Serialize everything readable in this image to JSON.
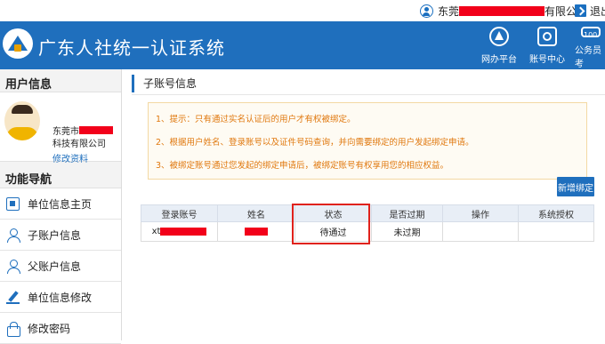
{
  "topbar": {
    "company_prefix": "东莞",
    "company_suffix": "有限公司",
    "logout_label": "退出"
  },
  "header": {
    "title": "广东人社统一认证系统",
    "nav": [
      {
        "label": "网办平台",
        "icon": "service-hall-icon"
      },
      {
        "label": "账号中心",
        "icon": "account-center-icon"
      },
      {
        "label": "公务员考",
        "icon": "civil-exam-icon"
      }
    ]
  },
  "sidebar": {
    "user_info_heading": "用户信息",
    "company_line1_prefix": "东莞市",
    "company_line2": "科技有限公司",
    "edit_profile": "修改资料",
    "nav_heading": "功能导航",
    "items": [
      {
        "label": "单位信息主页",
        "icon": "home-icon"
      },
      {
        "label": "子账户信息",
        "icon": "sub-account-icon"
      },
      {
        "label": "父账户信息",
        "icon": "parent-account-icon"
      },
      {
        "label": "单位信息修改",
        "icon": "edit-icon"
      },
      {
        "label": "修改密码",
        "icon": "lock-icon"
      }
    ]
  },
  "main": {
    "section_title": "子账号信息",
    "tips": [
      "1、提示：只有通过实名认证后的用户才有权被绑定。",
      "2、根据用户姓名、登录账号以及证件号码查询，并向需要绑定的用户发起绑定申请。",
      "3、被绑定账号通过您发起的绑定申请后，被绑定账号有权享用您的相应权益。"
    ],
    "new_bind_button": "新增绑定",
    "table": {
      "headers": [
        "登录账号",
        "姓名",
        "状态",
        "是否过期",
        "操作",
        "系统授权"
      ],
      "rows": [
        {
          "account_prefix": "xt",
          "status": "待通过",
          "expired": "未过期"
        }
      ]
    }
  },
  "colors": {
    "brand_blue": "#1f6fbd",
    "tip_orange": "#e0780e",
    "redaction_red": "#f2001a",
    "highlight_red": "#e0221c"
  }
}
